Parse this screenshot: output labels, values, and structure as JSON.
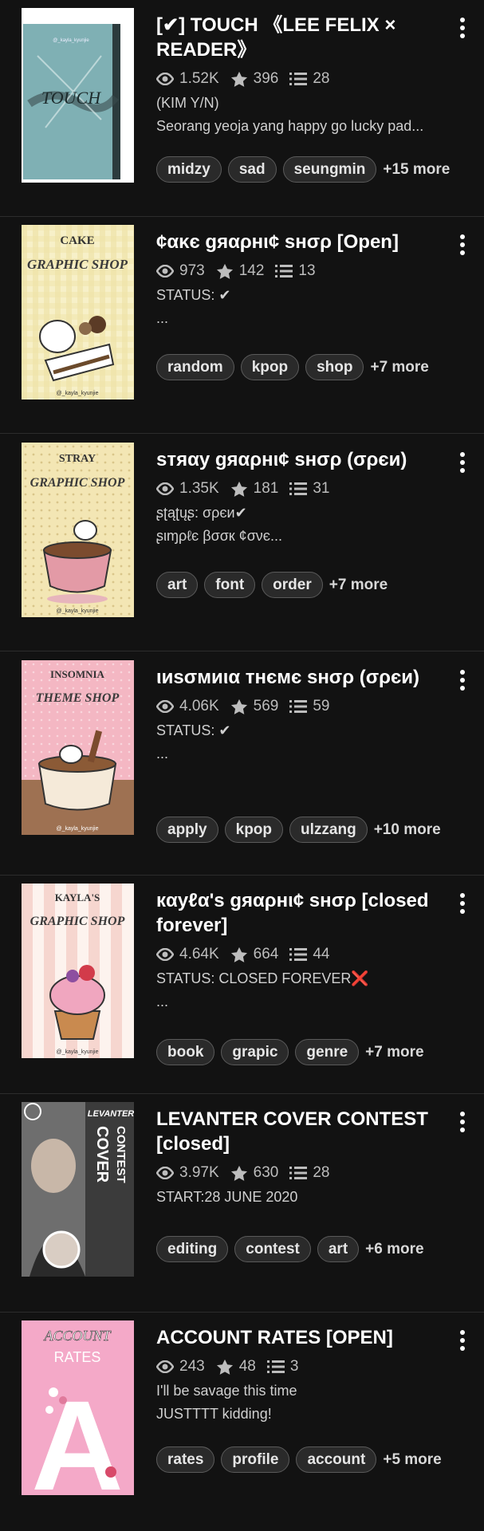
{
  "items": [
    {
      "title": "[✔] TOUCH 《LEE FELIX × READER》",
      "views": "1.52K",
      "votes": "396",
      "parts": "28",
      "desc1": "(KIM Y/N)",
      "desc2": "Seorang yeoja yang happy go lucky pad...",
      "tags": [
        "midzy",
        "sad",
        "seungmin"
      ],
      "more": "+15 more",
      "cover_text": "TOUCH",
      "cover_sub": "@_kayla_kyunjie"
    },
    {
      "title": "¢ακє gяαρнι¢ ѕнσρ [Open]",
      "views": "973",
      "votes": "142",
      "parts": "13",
      "desc1": "STATUS: ✔",
      "desc2": "...",
      "tags": [
        "random",
        "kpop",
        "shop"
      ],
      "more": "+7 more",
      "cover_text": "CAKE",
      "cover_sub": "GRAPHIC SHOP",
      "cover_foot": "@_kayla_kyunjie"
    },
    {
      "title": "ѕтяαу gяαρнι¢ ѕнσρ (σρєи)",
      "views": "1.35K",
      "votes": "181",
      "parts": "31",
      "desc1": "ʂʈąʈųʂ: σρєи✔",
      "desc2": "ʂιɱρℓє βσσк ¢σνє...",
      "tags": [
        "art",
        "font",
        "order"
      ],
      "more": "+7 more",
      "cover_text": "STRAY",
      "cover_sub": "GRAPHIC SHOP",
      "cover_foot": "@_kayla_kyunjie"
    },
    {
      "title": "ιиѕσмиια тнємє ѕнσρ (σρєи)",
      "views": "4.06K",
      "votes": "569",
      "parts": "59",
      "desc1": "STATUS: ✔",
      "desc2": "...",
      "tags": [
        "apply",
        "kpop",
        "ulzzang"
      ],
      "more": "+10 more",
      "cover_text": "INSOMNIA",
      "cover_sub": "THEME SHOP",
      "cover_foot": "@_kayla_kyunjie"
    },
    {
      "title": "кαуℓα'ѕ gяαρнι¢ ѕнσρ [closed forever]",
      "views": "4.64K",
      "votes": "664",
      "parts": "44",
      "desc1": "STATUS: CLOSED FOREVER❌",
      "desc2": "...",
      "tags": [
        "book",
        "grapic",
        "genre"
      ],
      "more": "+7 more",
      "cover_text": "KAYLA'S",
      "cover_sub": "GRAPHIC SHOP",
      "cover_foot": "@_kayla_kyunjie"
    },
    {
      "title": "LEVANTER COVER CONTEST [closed]",
      "views": "3.97K",
      "votes": "630",
      "parts": "28",
      "desc1": "START:28 JUNE 2020",
      "desc2": "",
      "tags": [
        "editing",
        "contest",
        "art"
      ],
      "more": "+6 more",
      "cover_text": "LEVANTER",
      "cover_sub": "COVER",
      "cover_foot": "CONTEST"
    },
    {
      "title": "ACCOUNT RATES [OPEN]",
      "views": "243",
      "votes": "48",
      "parts": "3",
      "desc1": "I'll be savage this time",
      "desc2": "JUSTTTT kidding!",
      "tags": [
        "rates",
        "profile",
        "account"
      ],
      "more": "+5 more",
      "cover_text": "ACCOUNT",
      "cover_sub": "RATES",
      "cover_foot": "A"
    }
  ],
  "colors": {
    "bg": "#121212",
    "text": "#ffffff",
    "meta": "#bdbdbd",
    "tag_bg": "#2a2a2a",
    "tag_border": "#5a5a5a",
    "divider": "#2c2c2c"
  },
  "icons": {
    "views": "eye-icon",
    "votes": "star-icon",
    "parts": "list-icon",
    "menu": "more-vertical-icon"
  }
}
